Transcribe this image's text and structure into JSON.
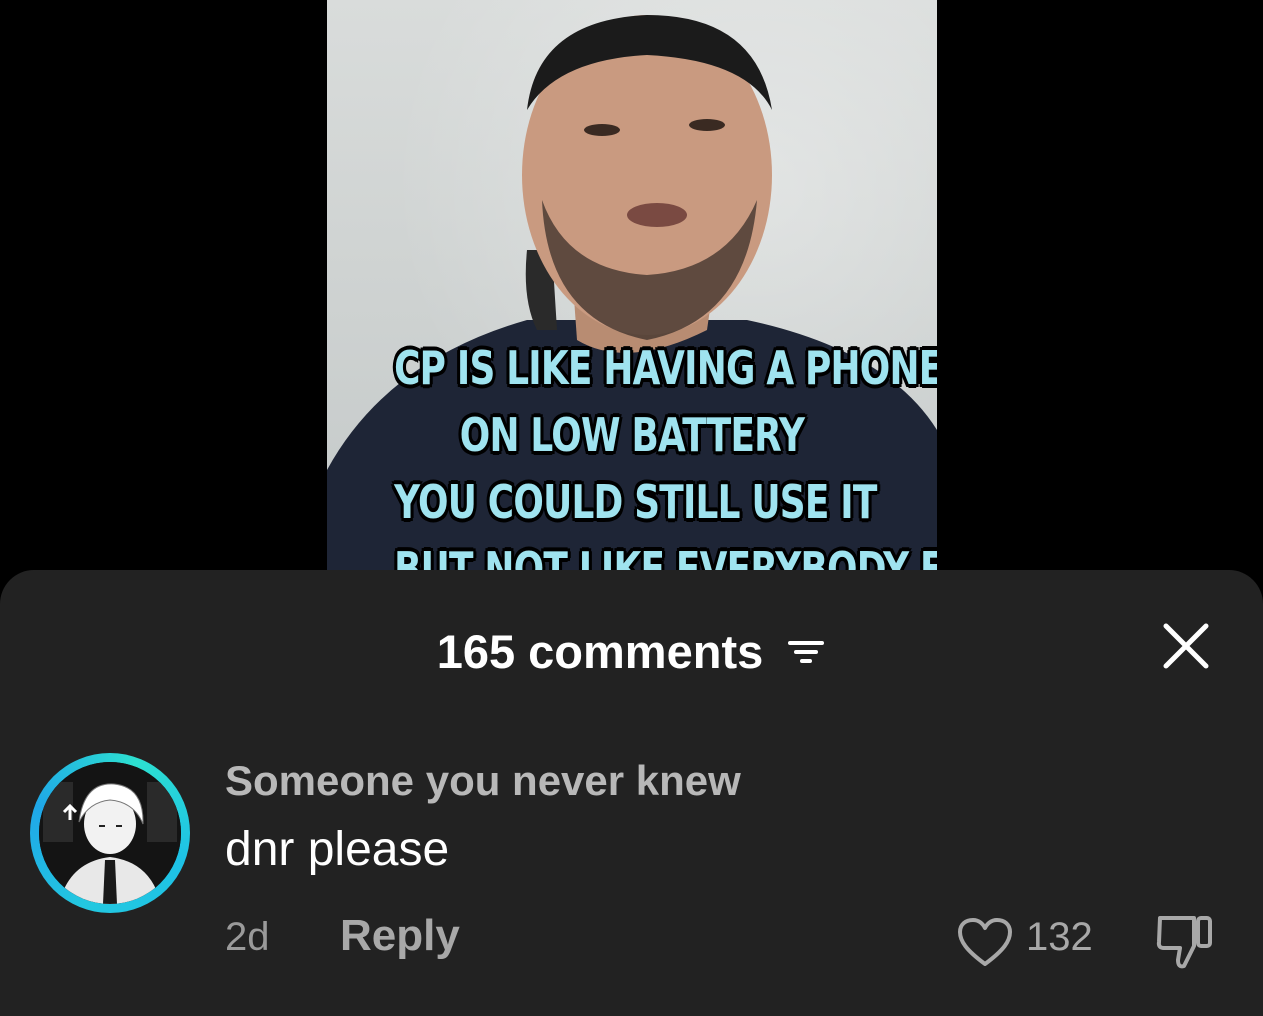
{
  "video": {
    "caption_lines": [
      "CP IS LIKE HAVING A PHONE",
      "ON LOW BATTERY",
      "YOU COULD STILL USE IT",
      "BUT NOT LIKE EVERYBODY ELSE"
    ]
  },
  "comments_sheet": {
    "title": "165 comments",
    "filter_icon": "sort-filter-icon",
    "close_icon": "close-icon"
  },
  "comment": {
    "username": "Someone you never knew",
    "text": "dnr please",
    "time": "2d",
    "reply_label": "Reply",
    "like_count": "132",
    "like_icon": "heart-outline-icon",
    "dislike_icon": "thumbs-down-icon"
  },
  "colors": {
    "sheet_bg": "#222222",
    "caption": "#9fe3ef",
    "avatar_ring": "#23c8e0"
  }
}
